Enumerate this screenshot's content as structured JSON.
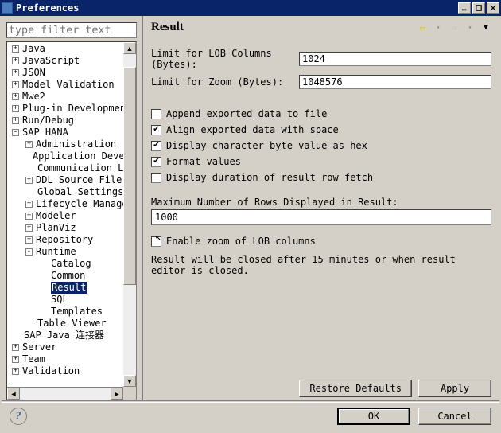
{
  "window": {
    "title": "Preferences"
  },
  "filter": {
    "placeholder": "type filter text"
  },
  "tree": [
    {
      "indent": 0,
      "exp": "+",
      "label": "Java"
    },
    {
      "indent": 0,
      "exp": "+",
      "label": "JavaScript"
    },
    {
      "indent": 0,
      "exp": "+",
      "label": "JSON"
    },
    {
      "indent": 0,
      "exp": "+",
      "label": "Model Validation"
    },
    {
      "indent": 0,
      "exp": "+",
      "label": "Mwe2"
    },
    {
      "indent": 0,
      "exp": "+",
      "label": "Plug-in Development"
    },
    {
      "indent": 0,
      "exp": "+",
      "label": "Run/Debug"
    },
    {
      "indent": 0,
      "exp": "-",
      "label": "SAP HANA"
    },
    {
      "indent": 1,
      "exp": "+",
      "label": "Administration"
    },
    {
      "indent": 1,
      "exp": "",
      "label": "Application Develo"
    },
    {
      "indent": 1,
      "exp": "",
      "label": "Communication Log"
    },
    {
      "indent": 1,
      "exp": "+",
      "label": "DDL Source File Ed"
    },
    {
      "indent": 1,
      "exp": "",
      "label": "Global Settings"
    },
    {
      "indent": 1,
      "exp": "+",
      "label": "Lifecycle Manageme"
    },
    {
      "indent": 1,
      "exp": "+",
      "label": "Modeler"
    },
    {
      "indent": 1,
      "exp": "+",
      "label": "PlanViz"
    },
    {
      "indent": 1,
      "exp": "+",
      "label": "Repository"
    },
    {
      "indent": 1,
      "exp": "-",
      "label": "Runtime"
    },
    {
      "indent": 2,
      "exp": "",
      "label": "Catalog"
    },
    {
      "indent": 2,
      "exp": "",
      "label": "Common"
    },
    {
      "indent": 2,
      "exp": "",
      "label": "Result",
      "selected": true
    },
    {
      "indent": 2,
      "exp": "",
      "label": "SQL"
    },
    {
      "indent": 2,
      "exp": "",
      "label": "Templates"
    },
    {
      "indent": 1,
      "exp": "",
      "label": "Table Viewer"
    },
    {
      "indent": 0,
      "exp": "",
      "label": "SAP Java 连接器"
    },
    {
      "indent": 0,
      "exp": "+",
      "label": "Server"
    },
    {
      "indent": 0,
      "exp": "+",
      "label": "Team"
    },
    {
      "indent": 0,
      "exp": "+",
      "label": "Validation"
    }
  ],
  "page": {
    "title": "Result",
    "lob_label": "Limit for LOB Columns (Bytes):",
    "lob_value": "1024",
    "zoom_label": "Limit for Zoom (Bytes):",
    "zoom_value": "1048576",
    "checks": {
      "append": {
        "label": "Append exported data to file",
        "checked": false
      },
      "align": {
        "label": "Align exported data with space",
        "checked": true
      },
      "hex": {
        "label": "Display character byte value as hex",
        "checked": true
      },
      "format": {
        "label": "Format values",
        "checked": true
      },
      "duration": {
        "label": "Display duration of result row fetch",
        "checked": false
      }
    },
    "maxrows_label": "Maximum Number of Rows Displayed in Result:",
    "maxrows_value": "1000",
    "enable_zoom": {
      "label": "Enable zoom of LOB columns",
      "checked": false
    },
    "note": "Result will be closed after 15 minutes or when result editor is closed."
  },
  "buttons": {
    "restore": "Restore Defaults",
    "apply": "Apply",
    "ok": "OK",
    "cancel": "Cancel"
  }
}
